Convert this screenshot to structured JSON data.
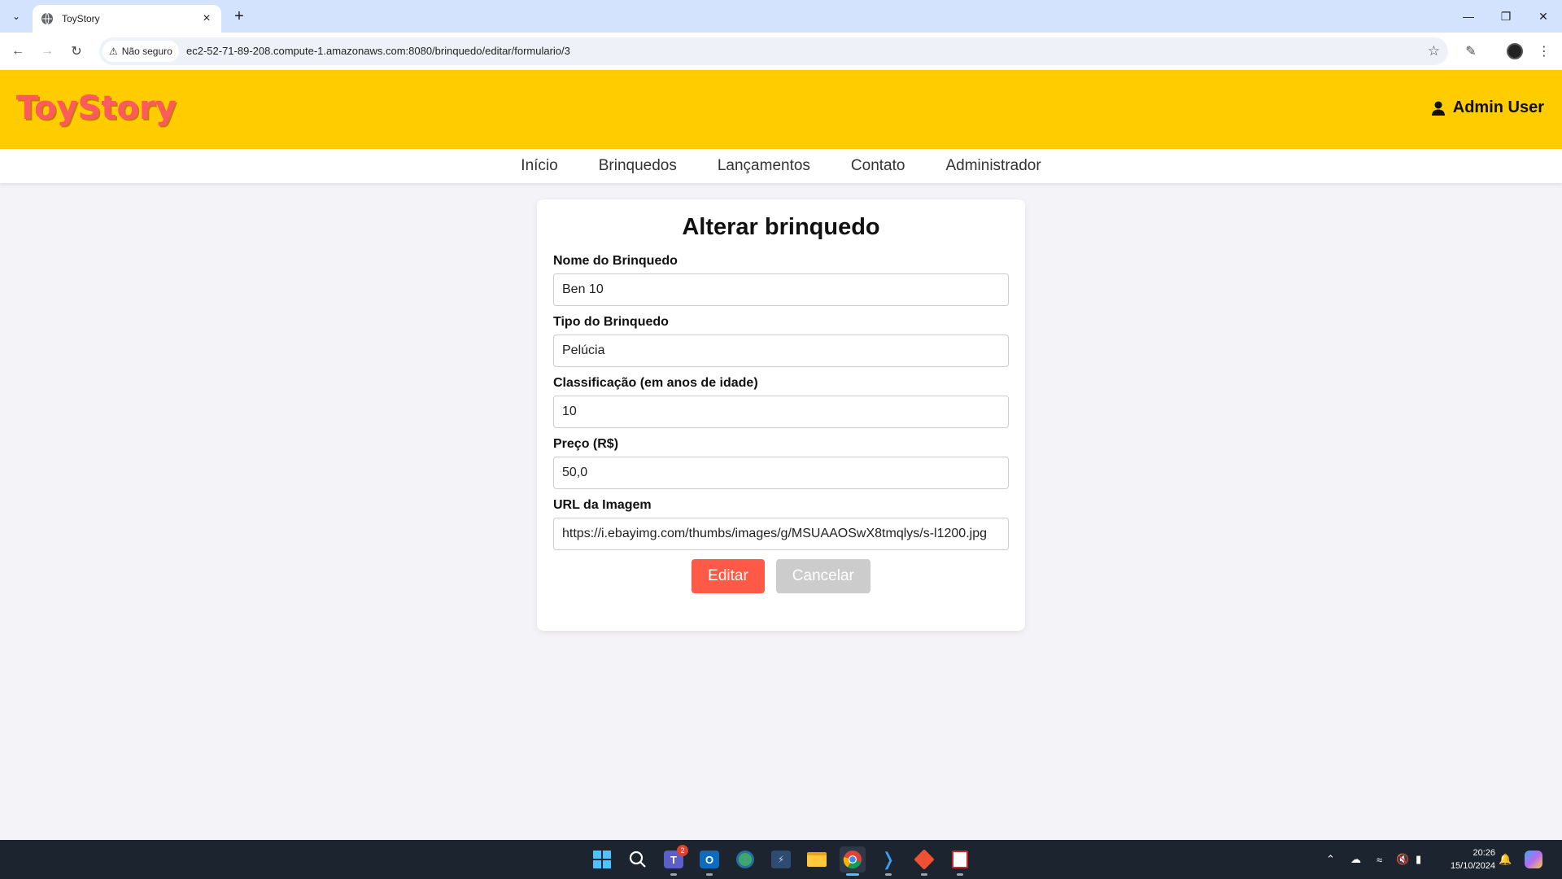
{
  "browser": {
    "tab_title": "ToyStory",
    "security_label": "Não seguro",
    "url": "ec2-52-71-89-208.compute-1.amazonaws.com:8080/brinquedo/editar/formulario/3"
  },
  "header": {
    "logo": "ToyStory",
    "user_name": "Admin User"
  },
  "nav": {
    "items": [
      "Início",
      "Brinquedos",
      "Lançamentos",
      "Contato",
      "Administrador"
    ]
  },
  "form": {
    "title": "Alterar brinquedo",
    "fields": [
      {
        "label": "Nome do Brinquedo",
        "value": "Ben 10"
      },
      {
        "label": "Tipo do Brinquedo",
        "value": "Pelúcia"
      },
      {
        "label": "Classificação (em anos de idade)",
        "value": "10"
      },
      {
        "label": "Preço (R$)",
        "value": "50,0"
      },
      {
        "label": "URL da Imagem",
        "value": "https://i.ebayimg.com/thumbs/images/g/MSUAAOSwX8tmqlys/s-l1200.jpg"
      }
    ],
    "edit_label": "Editar",
    "cancel_label": "Cancelar"
  },
  "colors": {
    "header_bg": "#ffcc00",
    "logo": "#ff5a5f",
    "edit_button": "#ff5a47",
    "cancel_button": "#cccccc"
  },
  "taskbar": {
    "teams_badge": "2",
    "time": "20:26",
    "date": "15/10/2024",
    "icons": [
      "windows-start-icon",
      "search-icon",
      "teams-icon",
      "outlook-icon",
      "edge-dev-icon",
      "sql-studio-icon",
      "file-explorer-icon",
      "chrome-icon",
      "vscode-icon",
      "git-icon",
      "app-icon"
    ]
  }
}
